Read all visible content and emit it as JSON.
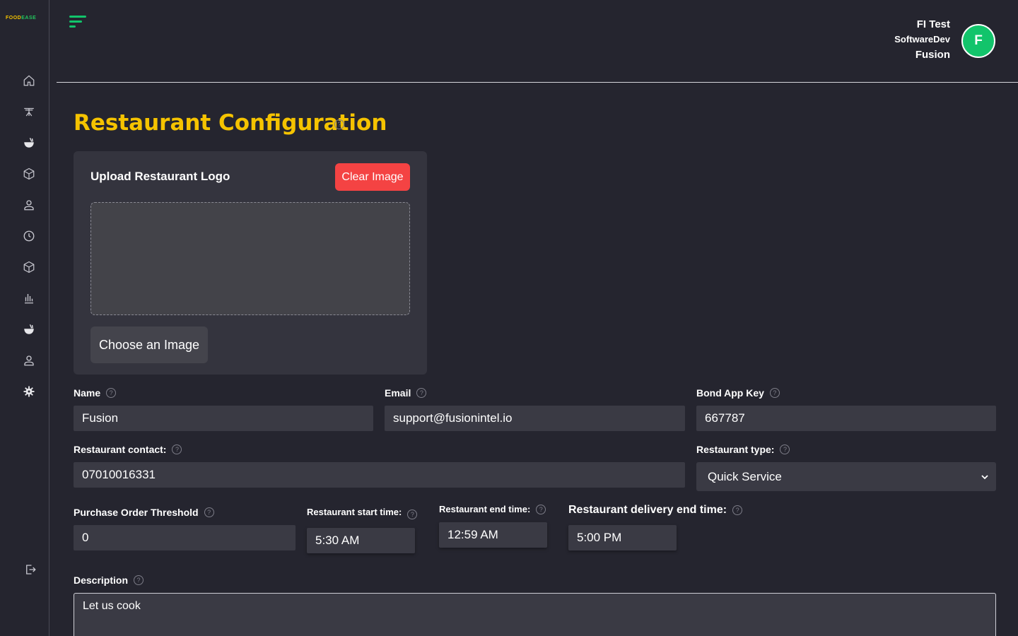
{
  "brand": {
    "logo_food": "FOOD",
    "logo_ease": "EASE"
  },
  "sidebar": {
    "items": [
      {
        "icon": "home-icon"
      },
      {
        "icon": "dining-table-icon"
      },
      {
        "icon": "food-bowl-icon"
      },
      {
        "icon": "box-icon"
      },
      {
        "icon": "user-icon"
      },
      {
        "icon": "clock-icon"
      },
      {
        "icon": "package-icon"
      },
      {
        "icon": "bar-chart-icon"
      },
      {
        "icon": "food-icon"
      },
      {
        "icon": "staff-icon"
      },
      {
        "icon": "settings-icon"
      }
    ],
    "logout_icon": "logout-icon"
  },
  "header": {
    "user_name": "FI Test",
    "user_role": "SoftwareDev",
    "user_org": "Fusion",
    "avatar_letter": "F"
  },
  "page": {
    "title": "Restaurant Configuration",
    "help_glyph": "?"
  },
  "upload": {
    "title": "Upload Restaurant Logo",
    "clear_label": "Clear Image",
    "choose_label": "Choose an Image"
  },
  "form": {
    "name": {
      "label": "Name",
      "value": "Fusion"
    },
    "email": {
      "label": "Email",
      "value": "support@fusionintel.io"
    },
    "bond_app_key": {
      "label": "Bond App Key",
      "value": "667787"
    },
    "contact": {
      "label": "Restaurant contact:",
      "value": "07010016331"
    },
    "type": {
      "label": "Restaurant type:",
      "value": "Quick Service"
    },
    "po_threshold": {
      "label": "Purchase Order Threshold",
      "value": "0"
    },
    "start_time": {
      "label": "Restaurant start time:",
      "value": "5:30 AM"
    },
    "end_time": {
      "label": "Restaurant end time:",
      "value": "12:59 AM"
    },
    "delivery_end_time": {
      "label": "Restaurant delivery end time:",
      "value": "5:00 PM"
    },
    "description": {
      "label": "Description",
      "value": "Let us cook"
    }
  },
  "colors": {
    "accent": "#f5c300",
    "brand_green": "#12c46b",
    "danger": "#f44343",
    "background": "#25252f"
  }
}
